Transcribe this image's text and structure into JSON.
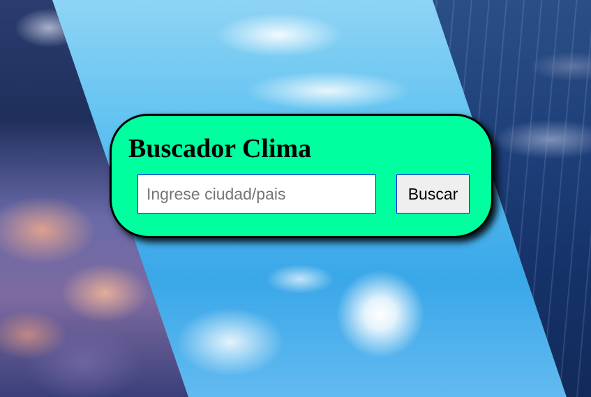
{
  "app": {
    "title": "Buscador Clima"
  },
  "search": {
    "value": "",
    "placeholder": "Ingrese ciudad/pais",
    "button_label": "Buscar"
  },
  "colors": {
    "card_background": "#00ff9f",
    "card_border": "#000000",
    "field_border": "#1a1aff",
    "button_background": "#efefef"
  },
  "background": {
    "panels": [
      "cloudy-dusk-sky",
      "sunny-blue-sky",
      "rainy-night-sky"
    ]
  }
}
